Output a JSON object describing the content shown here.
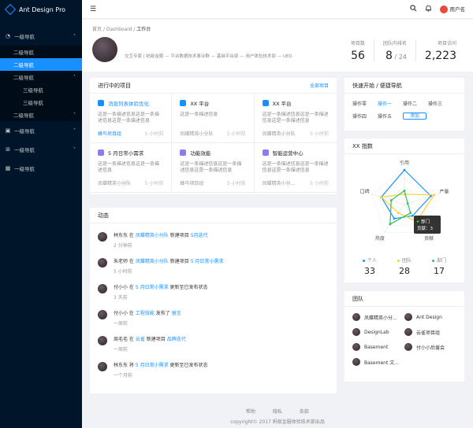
{
  "app": {
    "title": "Ant Design Pro"
  },
  "sidebar": {
    "items": [
      {
        "label": "一级导航",
        "icon": "dashboard-icon",
        "level": 1,
        "arrow": "^"
      },
      {
        "label": "二级导航",
        "level": 2
      },
      {
        "label": "二级导航",
        "level": 2,
        "active": true
      },
      {
        "label": "二级导航",
        "level": 2,
        "arrow": "^"
      },
      {
        "label": "三级导航",
        "level": 3
      },
      {
        "label": "三级导航",
        "level": 3
      },
      {
        "label": "二级导航",
        "level": 2,
        "arrow": "v"
      },
      {
        "label": "一级导航",
        "icon": "image-icon",
        "level": 1,
        "arrow": "v"
      },
      {
        "label": "一级导航",
        "icon": "table-icon",
        "level": 1,
        "arrow": "v"
      },
      {
        "label": "一级导航",
        "icon": "calendar-icon",
        "level": 1
      }
    ]
  },
  "header": {
    "username": "用户名"
  },
  "breadcrumb": [
    "首页",
    "Dashboard",
    "工作台"
  ],
  "user": {
    "greeting": "",
    "desc": "交互专家 | 蚂蚁金服 — 平台数据技术事业群 — 基础平台部 — 用户体验技术部 — UED"
  },
  "stats": [
    {
      "title": "项目数",
      "value": "56"
    },
    {
      "title": "团队内排名",
      "value": "8",
      "suffix": " / 24"
    },
    {
      "title": "项目访问",
      "value": "2,223"
    }
  ],
  "projects": {
    "title": "进行中的项目",
    "extra": "全部项目",
    "items": [
      {
        "name": "消息列表体验优化",
        "desc": "这是一条描述信息这是一条描述信息这是一条描述信息",
        "team": "蜂鸟项目组",
        "time": "5 小时前",
        "color": "#1890ff",
        "name_link": true,
        "team_link": true
      },
      {
        "name": "XX 平台",
        "desc": "这是一条描述信息",
        "team": "凤蝶精英小分队",
        "time": "5 小时前",
        "color": "#1890ff"
      },
      {
        "name": "XX 平台",
        "desc": "这是一条描述信息这是一条描述信息这是一条描述信息",
        "team": "凤蝶精英小分队",
        "time": "5 小时前",
        "color": "#1890ff"
      },
      {
        "name": "5 月日常小需求",
        "desc": "这是一条描述信息这是一条描述信息",
        "team": "凤蝶精英小分队",
        "time": "5 小时前",
        "color": "#8c7cf0"
      },
      {
        "name": "功能效能",
        "desc": "这是一条描述信息这是一条描述信息这是一条描述信息",
        "team": "蜂鸟项目组",
        "time": "5 小时前",
        "color": "#8c7cf0"
      },
      {
        "name": "智能运营中心",
        "desc": "这是一条描述信息这是一条描述信息这是一条描述信息",
        "team": "凤蝶精英小分...",
        "time": "5 小时前",
        "color": "#8c7cf0"
      }
    ]
  },
  "activity": {
    "title": "动态",
    "items": [
      {
        "user": "林东东",
        "pre": " 在 ",
        "group": "凤蝶精英小分队",
        "mid": " 新建项目 ",
        "target": "5月迭代",
        "post": "",
        "time": "2 分钟前"
      },
      {
        "user": "朱老师",
        "pre": " 在 ",
        "group": "凤蝶精英小分队",
        "mid": " 新建项目 ",
        "target": "5 月日常小需求",
        "post": "",
        "time": "5 小时前"
      },
      {
        "user": "付小小",
        "pre": " 在 ",
        "group": "5 月日常小需求",
        "mid": " 更新至已发布状态",
        "target": "",
        "post": "",
        "time": "3 天前"
      },
      {
        "user": "付小小",
        "pre": " 在 ",
        "group": "工程效能",
        "mid": " 发布了 ",
        "target": "留言",
        "post": "",
        "time": "一周前"
      },
      {
        "user": "周毛毛",
        "pre": " 在 ",
        "group": "云雀",
        "mid": " 新建项目 ",
        "target": "品牌迭代",
        "post": "",
        "time": "一周前"
      },
      {
        "user": "林东东",
        "pre": " 将 ",
        "group": "5 月日常小需求",
        "mid": " 更新至已发布状态",
        "target": "",
        "post": "",
        "time": "一个月前"
      }
    ]
  },
  "quicknav": {
    "title": "快速开始 / 便捷导航",
    "links": [
      "操作零",
      "操作一",
      "操作二",
      "操作三",
      "操作四",
      "操作五"
    ],
    "active_index": 1,
    "add_label": "添加"
  },
  "radar": {
    "title": "XX 指数",
    "tooltip_title": "部门",
    "tooltip_value": "贡献：3",
    "legend": [
      {
        "name": "个人",
        "value": "33",
        "color": "#1890ff"
      },
      {
        "name": "团队",
        "value": "28",
        "color": "#fad337"
      },
      {
        "name": "部门",
        "value": "17",
        "color": "#2fc25b"
      }
    ]
  },
  "chart_data": {
    "type": "radar",
    "categories": [
      "引用",
      "产量",
      "贡献",
      "热度",
      "口碑"
    ],
    "max": 10,
    "series": [
      {
        "name": "个人",
        "values": [
          10,
          8,
          4,
          5,
          7
        ],
        "color": "#1890ff"
      },
      {
        "name": "团队",
        "values": [
          3,
          9,
          6,
          3,
          7
        ],
        "color": "#fad337"
      },
      {
        "name": "部门",
        "values": [
          4,
          1,
          3,
          7,
          4
        ],
        "color": "#2fc25b"
      }
    ]
  },
  "team": {
    "title": "团队",
    "members": [
      "凤蝶精英小分...",
      "Ant Design",
      "DesignLab",
      "云雀项目组",
      "Basement",
      "付小小后援会",
      "Basement 文..."
    ]
  },
  "footer": {
    "links": [
      "帮助",
      "隐私",
      "条款"
    ],
    "copyright": "copyright© 2017 蚂蚁金服体验技术部出品"
  }
}
